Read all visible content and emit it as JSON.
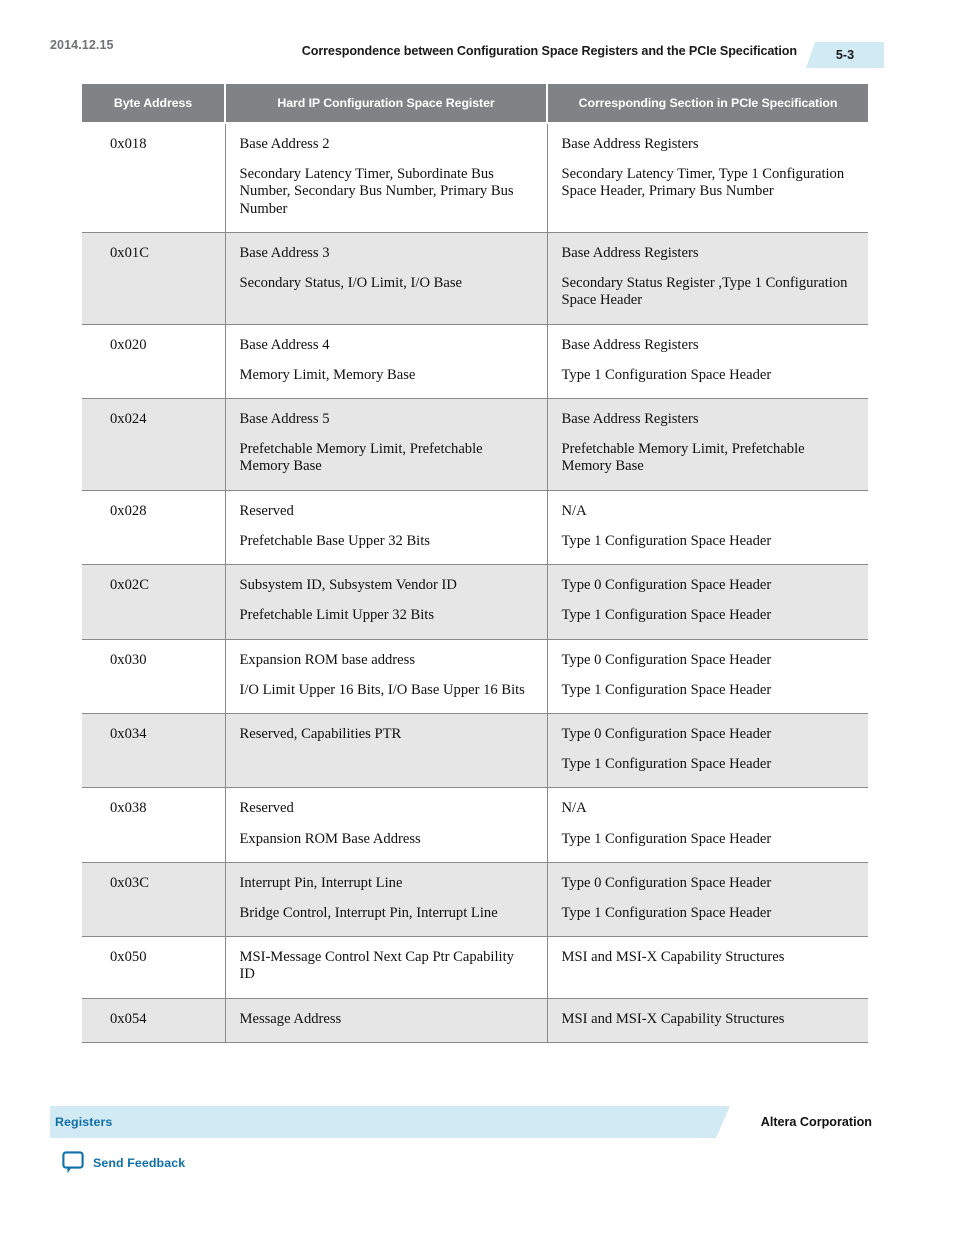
{
  "header": {
    "date": "2014.12.15",
    "title": "Correspondence between Configuration Space Registers and the PCIe Specification",
    "page_number": "5-3",
    "badge_color": "#d2eaf4"
  },
  "table": {
    "header_bg": "#808285",
    "shaded_row_bg": "#e6e6e6",
    "columns": [
      "Byte Address",
      "Hard IP Configuration Space Register",
      "Corresponding Section in PCIe Specification"
    ],
    "rows": [
      {
        "shaded": false,
        "address": "0x018",
        "register": [
          "Base Address 2",
          "Secondary Latency Timer, Subordinate Bus Number, Secondary Bus Number, Primary Bus Number"
        ],
        "section": [
          "Base Address Registers",
          "Secondary Latency Timer, Type 1 Configuration Space Header, Primary Bus Number"
        ]
      },
      {
        "shaded": true,
        "address": "0x01C",
        "register": [
          "Base Address 3",
          "Secondary Status, I/O Limit, I/O Base"
        ],
        "section": [
          "Base Address Registers",
          "Secondary Status Register ,Type 1 Configuration Space Header"
        ]
      },
      {
        "shaded": false,
        "address": "0x020",
        "register": [
          "Base Address 4",
          "Memory Limit, Memory Base"
        ],
        "section": [
          "Base Address Registers",
          "Type 1 Configuration Space Header"
        ]
      },
      {
        "shaded": true,
        "address": "0x024",
        "register": [
          "Base Address 5",
          "Prefetchable Memory Limit, Prefetchable Memory Base"
        ],
        "section": [
          "Base Address Registers",
          "Prefetchable Memory Limit, Prefetchable Memory Base"
        ]
      },
      {
        "shaded": false,
        "address": "0x028",
        "register": [
          "Reserved",
          "Prefetchable Base Upper 32 Bits"
        ],
        "section": [
          "N/A",
          "Type 1 Configuration Space Header"
        ]
      },
      {
        "shaded": true,
        "address": "0x02C",
        "register": [
          "Subsystem ID, Subsystem Vendor ID",
          "Prefetchable Limit Upper 32 Bits"
        ],
        "section": [
          "Type 0 Configuration Space Header",
          "Type 1 Configuration Space Header"
        ]
      },
      {
        "shaded": false,
        "address": "0x030",
        "register": [
          "Expansion ROM base address",
          "I/O Limit Upper 16 Bits, I/O Base Upper 16 Bits"
        ],
        "section": [
          "Type 0 Configuration Space Header",
          "Type 1 Configuration Space Header"
        ]
      },
      {
        "shaded": true,
        "address": "0x034",
        "register": [
          "Reserved, Capabilities PTR"
        ],
        "section": [
          "Type 0 Configuration Space Header",
          "Type 1 Configuration Space Header"
        ]
      },
      {
        "shaded": false,
        "address": "0x038",
        "register": [
          "Reserved",
          "Expansion ROM Base Address"
        ],
        "section": [
          "N/A",
          "Type 1 Configuration Space Header"
        ]
      },
      {
        "shaded": true,
        "address": "0x03C",
        "register": [
          "Interrupt Pin, Interrupt Line",
          "Bridge Control, Interrupt Pin, Interrupt Line"
        ],
        "section": [
          "Type 0 Configuration Space Header",
          "Type 1 Configuration Space Header"
        ]
      },
      {
        "shaded": false,
        "address": "0x050",
        "register": [
          "MSI-Message Control Next Cap Ptr Capability ID"
        ],
        "section": [
          "MSI and MSI-X Capability Structures"
        ]
      },
      {
        "shaded": true,
        "address": "0x054",
        "register": [
          "Message Address"
        ],
        "section": [
          "MSI and MSI-X Capability Structures"
        ]
      }
    ]
  },
  "footer": {
    "section_label": "Registers",
    "corporation": "Altera Corporation",
    "feedback_label": "Send Feedback",
    "link_color": "#0f6fa8",
    "band_color": "#d2eaf4"
  }
}
